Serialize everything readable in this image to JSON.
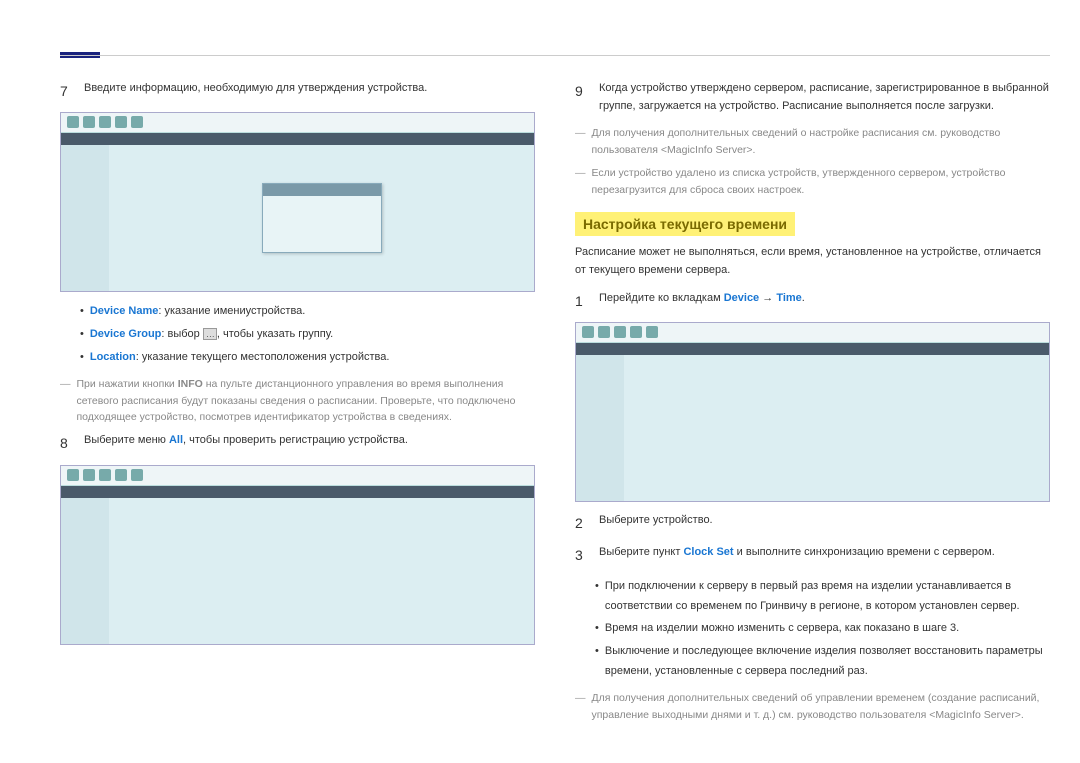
{
  "left": {
    "step7": {
      "num": "7",
      "text": "Введите информацию, необходимую для утверждения устройства."
    },
    "bullets": {
      "device_name_label": "Device Name",
      "device_name_text": ": указание имениустройства.",
      "device_group_label": "Device Group",
      "device_group_text_a": ": выбор ",
      "device_group_text_b": ", чтобы указать группу.",
      "location_label": "Location",
      "location_text": ": указание текущего местоположения устройства."
    },
    "info_note": {
      "prefix": "При нажатии кнопки ",
      "info": "INFO",
      "suffix": " на пульте дистанционного управления во время выполнения сетевого расписания будут показаны сведения о расписании. Проверьте, что подключено подходящее устройство, посмотрев идентификатор устройства в сведениях."
    },
    "step8": {
      "num": "8",
      "text_a": "Выберите меню ",
      "all": "All",
      "text_b": ", чтобы проверить регистрацию устройства."
    }
  },
  "right": {
    "step9": {
      "num": "9",
      "text": "Когда устройство утверждено сервером, расписание, зарегистрированное в выбранной группе, загружается на устройство. Расписание выполняется после загрузки."
    },
    "dash1": "Для получения дополнительных сведений о настройке расписания см. руководство пользователя <MagicInfo Server>.",
    "dash2": "Если устройство удалено из списка устройств, утвержденного сервером, устройство перезагрузится для сброса своих настроек.",
    "section_title": "Настройка текущего времени",
    "section_desc": "Расписание может не выполняться, если время, установленное на устройстве, отличается от текущего времени сервера.",
    "step1": {
      "num": "1",
      "text_a": "Перейдите ко вкладкам ",
      "device": "Device",
      "arrow": " → ",
      "time": "Time",
      "dot": "."
    },
    "step2": {
      "num": "2",
      "text": "Выберите устройство."
    },
    "step3": {
      "num": "3",
      "text_a": "Выберите пункт ",
      "clockset": "Clock Set",
      "text_b": " и выполните синхронизацию времени с сервером."
    },
    "bullets2": {
      "b1": "При подключении к серверу в первый раз время на изделии устанавливается в соответствии со временем по Гринвичу в регионе, в котором установлен сервер.",
      "b2": "Время на изделии можно изменить с сервера, как показано в шаге 3.",
      "b3": "Выключение и последующее включение изделия позволяет восстановить параметры времени, установленные с сервера последний раз."
    },
    "dash3": "Для получения дополнительных сведений об управлении временем (создание расписаний, управление выходными днями и т. д.) см. руководство пользователя <MagicInfo Server>."
  }
}
